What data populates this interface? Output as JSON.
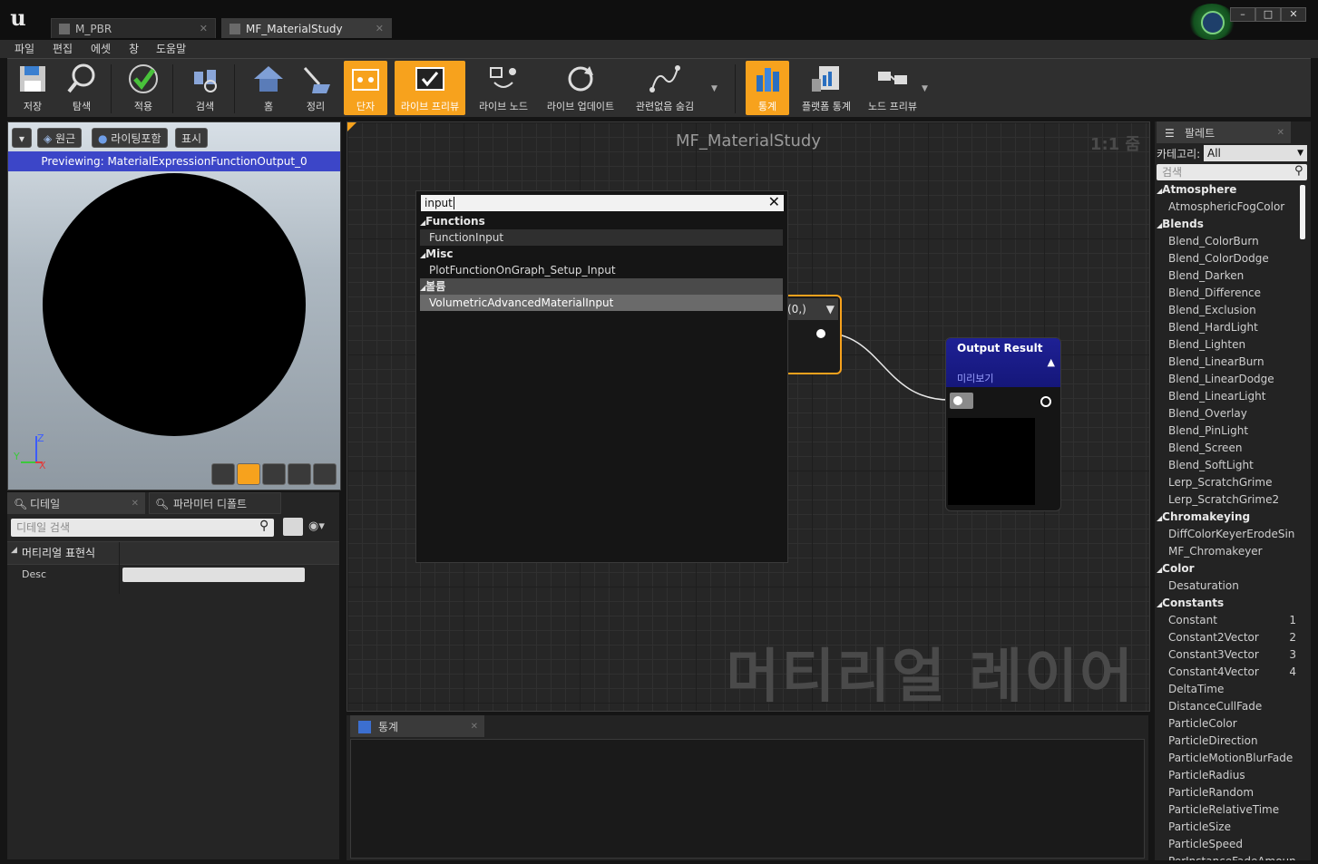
{
  "titlebar": {
    "logo": "u",
    "tabs": [
      {
        "label": "M_PBR",
        "active": false
      },
      {
        "label": "MF_MaterialStudy",
        "active": true
      }
    ],
    "controls": [
      "–",
      "□",
      "✕"
    ]
  },
  "menu": [
    "파일",
    "편집",
    "에셋",
    "창",
    "도움말"
  ],
  "toolbar": {
    "items": [
      {
        "label": "저장",
        "icon": "save-icon",
        "on": false
      },
      {
        "label": "탐색",
        "icon": "browse-icon",
        "on": false
      },
      {
        "label": "적용",
        "icon": "apply-icon",
        "on": false
      },
      {
        "label": "검색",
        "icon": "search-icon",
        "on": false
      },
      {
        "label": "홈",
        "icon": "home-icon",
        "on": false
      },
      {
        "label": "정리",
        "icon": "clean-icon",
        "on": false
      },
      {
        "label": "단자",
        "icon": "connectors-icon",
        "on": true
      },
      {
        "label": "라이브 프리뷰",
        "icon": "live-preview-icon",
        "on": true
      },
      {
        "label": "라이브 노드",
        "icon": "live-nodes-icon",
        "on": false
      },
      {
        "label": "라이브 업데이트",
        "icon": "live-update-icon",
        "on": false
      },
      {
        "label": "관련없음 숨김",
        "icon": "hide-unrelated-icon",
        "on": false
      },
      {
        "label": "통계",
        "icon": "stats-icon",
        "on": true
      },
      {
        "label": "플랫폼 통계",
        "icon": "platform-stats-icon",
        "on": false
      },
      {
        "label": "노드 프리뷰",
        "icon": "node-preview-icon",
        "on": false
      }
    ]
  },
  "viewport": {
    "buttons": [
      "원근",
      "라이팅포함",
      "표시"
    ],
    "banner": "Previewing: MaterialExpressionFunctionOutput_0",
    "axis_z": "Z",
    "axis_x": "X",
    "axis_y": "Y"
  },
  "details": {
    "tabs": [
      "디테일",
      "파라미터 디폴트"
    ],
    "search_placeholder": "디테일 검색",
    "section": "머티리얼 표현식",
    "field_label": "Desc",
    "field_value": ""
  },
  "graph": {
    "title": "MF_MaterialStudy",
    "zoom": "1:1 줌",
    "watermark": "머티리얼 레이어"
  },
  "action_menu": {
    "query": "input",
    "categories": [
      {
        "name": "Functions",
        "items": [
          "FunctionInput"
        ]
      },
      {
        "name": "Misc",
        "items": [
          "PlotFunctionOnGraph_Setup_Input"
        ]
      },
      {
        "name": "볼륨",
        "items": [
          "VolumetricAdvancedMaterialInput"
        ]
      }
    ]
  },
  "nodes": {
    "function_header": "(0,)",
    "output_title": "Output Result",
    "output_sub": "미리보기"
  },
  "stats": {
    "tab": "통계"
  },
  "palette": {
    "tab": "팔레트",
    "category_label": "카테고리:",
    "category_value": "All",
    "search_placeholder": "검색",
    "rows": [
      {
        "text": "Atmosphere",
        "cat": true
      },
      {
        "text": "AtmosphericFogColor",
        "cat": false
      },
      {
        "text": "Blends",
        "cat": true
      },
      {
        "text": "Blend_ColorBurn",
        "cat": false
      },
      {
        "text": "Blend_ColorDodge",
        "cat": false
      },
      {
        "text": "Blend_Darken",
        "cat": false
      },
      {
        "text": "Blend_Difference",
        "cat": false
      },
      {
        "text": "Blend_Exclusion",
        "cat": false
      },
      {
        "text": "Blend_HardLight",
        "cat": false
      },
      {
        "text": "Blend_Lighten",
        "cat": false
      },
      {
        "text": "Blend_LinearBurn",
        "cat": false
      },
      {
        "text": "Blend_LinearDodge",
        "cat": false
      },
      {
        "text": "Blend_LinearLight",
        "cat": false
      },
      {
        "text": "Blend_Overlay",
        "cat": false
      },
      {
        "text": "Blend_PinLight",
        "cat": false
      },
      {
        "text": "Blend_Screen",
        "cat": false
      },
      {
        "text": "Blend_SoftLight",
        "cat": false
      },
      {
        "text": "Lerp_ScratchGrime",
        "cat": false
      },
      {
        "text": "Lerp_ScratchGrime2",
        "cat": false
      },
      {
        "text": "Chromakeying",
        "cat": true
      },
      {
        "text": "DiffColorKeyerErodeSin",
        "cat": false
      },
      {
        "text": "MF_Chromakeyer",
        "cat": false
      },
      {
        "text": "Color",
        "cat": true
      },
      {
        "text": "Desaturation",
        "cat": false
      },
      {
        "text": "Constants",
        "cat": true
      },
      {
        "text": "Constant",
        "cat": false,
        "num": "1"
      },
      {
        "text": "Constant2Vector",
        "cat": false,
        "num": "2"
      },
      {
        "text": "Constant3Vector",
        "cat": false,
        "num": "3"
      },
      {
        "text": "Constant4Vector",
        "cat": false,
        "num": "4"
      },
      {
        "text": "DeltaTime",
        "cat": false
      },
      {
        "text": "DistanceCullFade",
        "cat": false
      },
      {
        "text": "ParticleColor",
        "cat": false
      },
      {
        "text": "ParticleDirection",
        "cat": false
      },
      {
        "text": "ParticleMotionBlurFade",
        "cat": false
      },
      {
        "text": "ParticleRadius",
        "cat": false
      },
      {
        "text": "ParticleRandom",
        "cat": false
      },
      {
        "text": "ParticleRelativeTime",
        "cat": false
      },
      {
        "text": "ParticleSize",
        "cat": false
      },
      {
        "text": "ParticleSpeed",
        "cat": false
      },
      {
        "text": "PerInstanceFadeAmoun",
        "cat": false
      }
    ]
  }
}
